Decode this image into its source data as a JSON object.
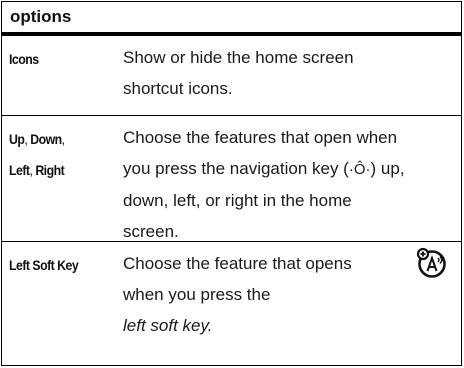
{
  "header": {
    "title": "options"
  },
  "rows": [
    {
      "label": "Icons",
      "lines": [
        "Show or hide the home screen",
        "shortcut icons."
      ]
    },
    {
      "label_parts": [
        "Up",
        ", ",
        "Down",
        ",",
        "Left",
        ", ",
        "Right"
      ],
      "lines": [
        "Choose the features that open when",
        "you press the navigation key (",
        "nav_glyph",
        ") up,",
        "down, left, or right in the home",
        "screen."
      ],
      "nav_glyph": "·Ô·"
    },
    {
      "label": "Left Soft Key",
      "lines": [
        "Choose the feature that opens",
        "when you press the",
        "left soft key."
      ]
    }
  ],
  "icons": {
    "nav_key": "navigation-key-icon",
    "voice": "voice-name-icon"
  }
}
